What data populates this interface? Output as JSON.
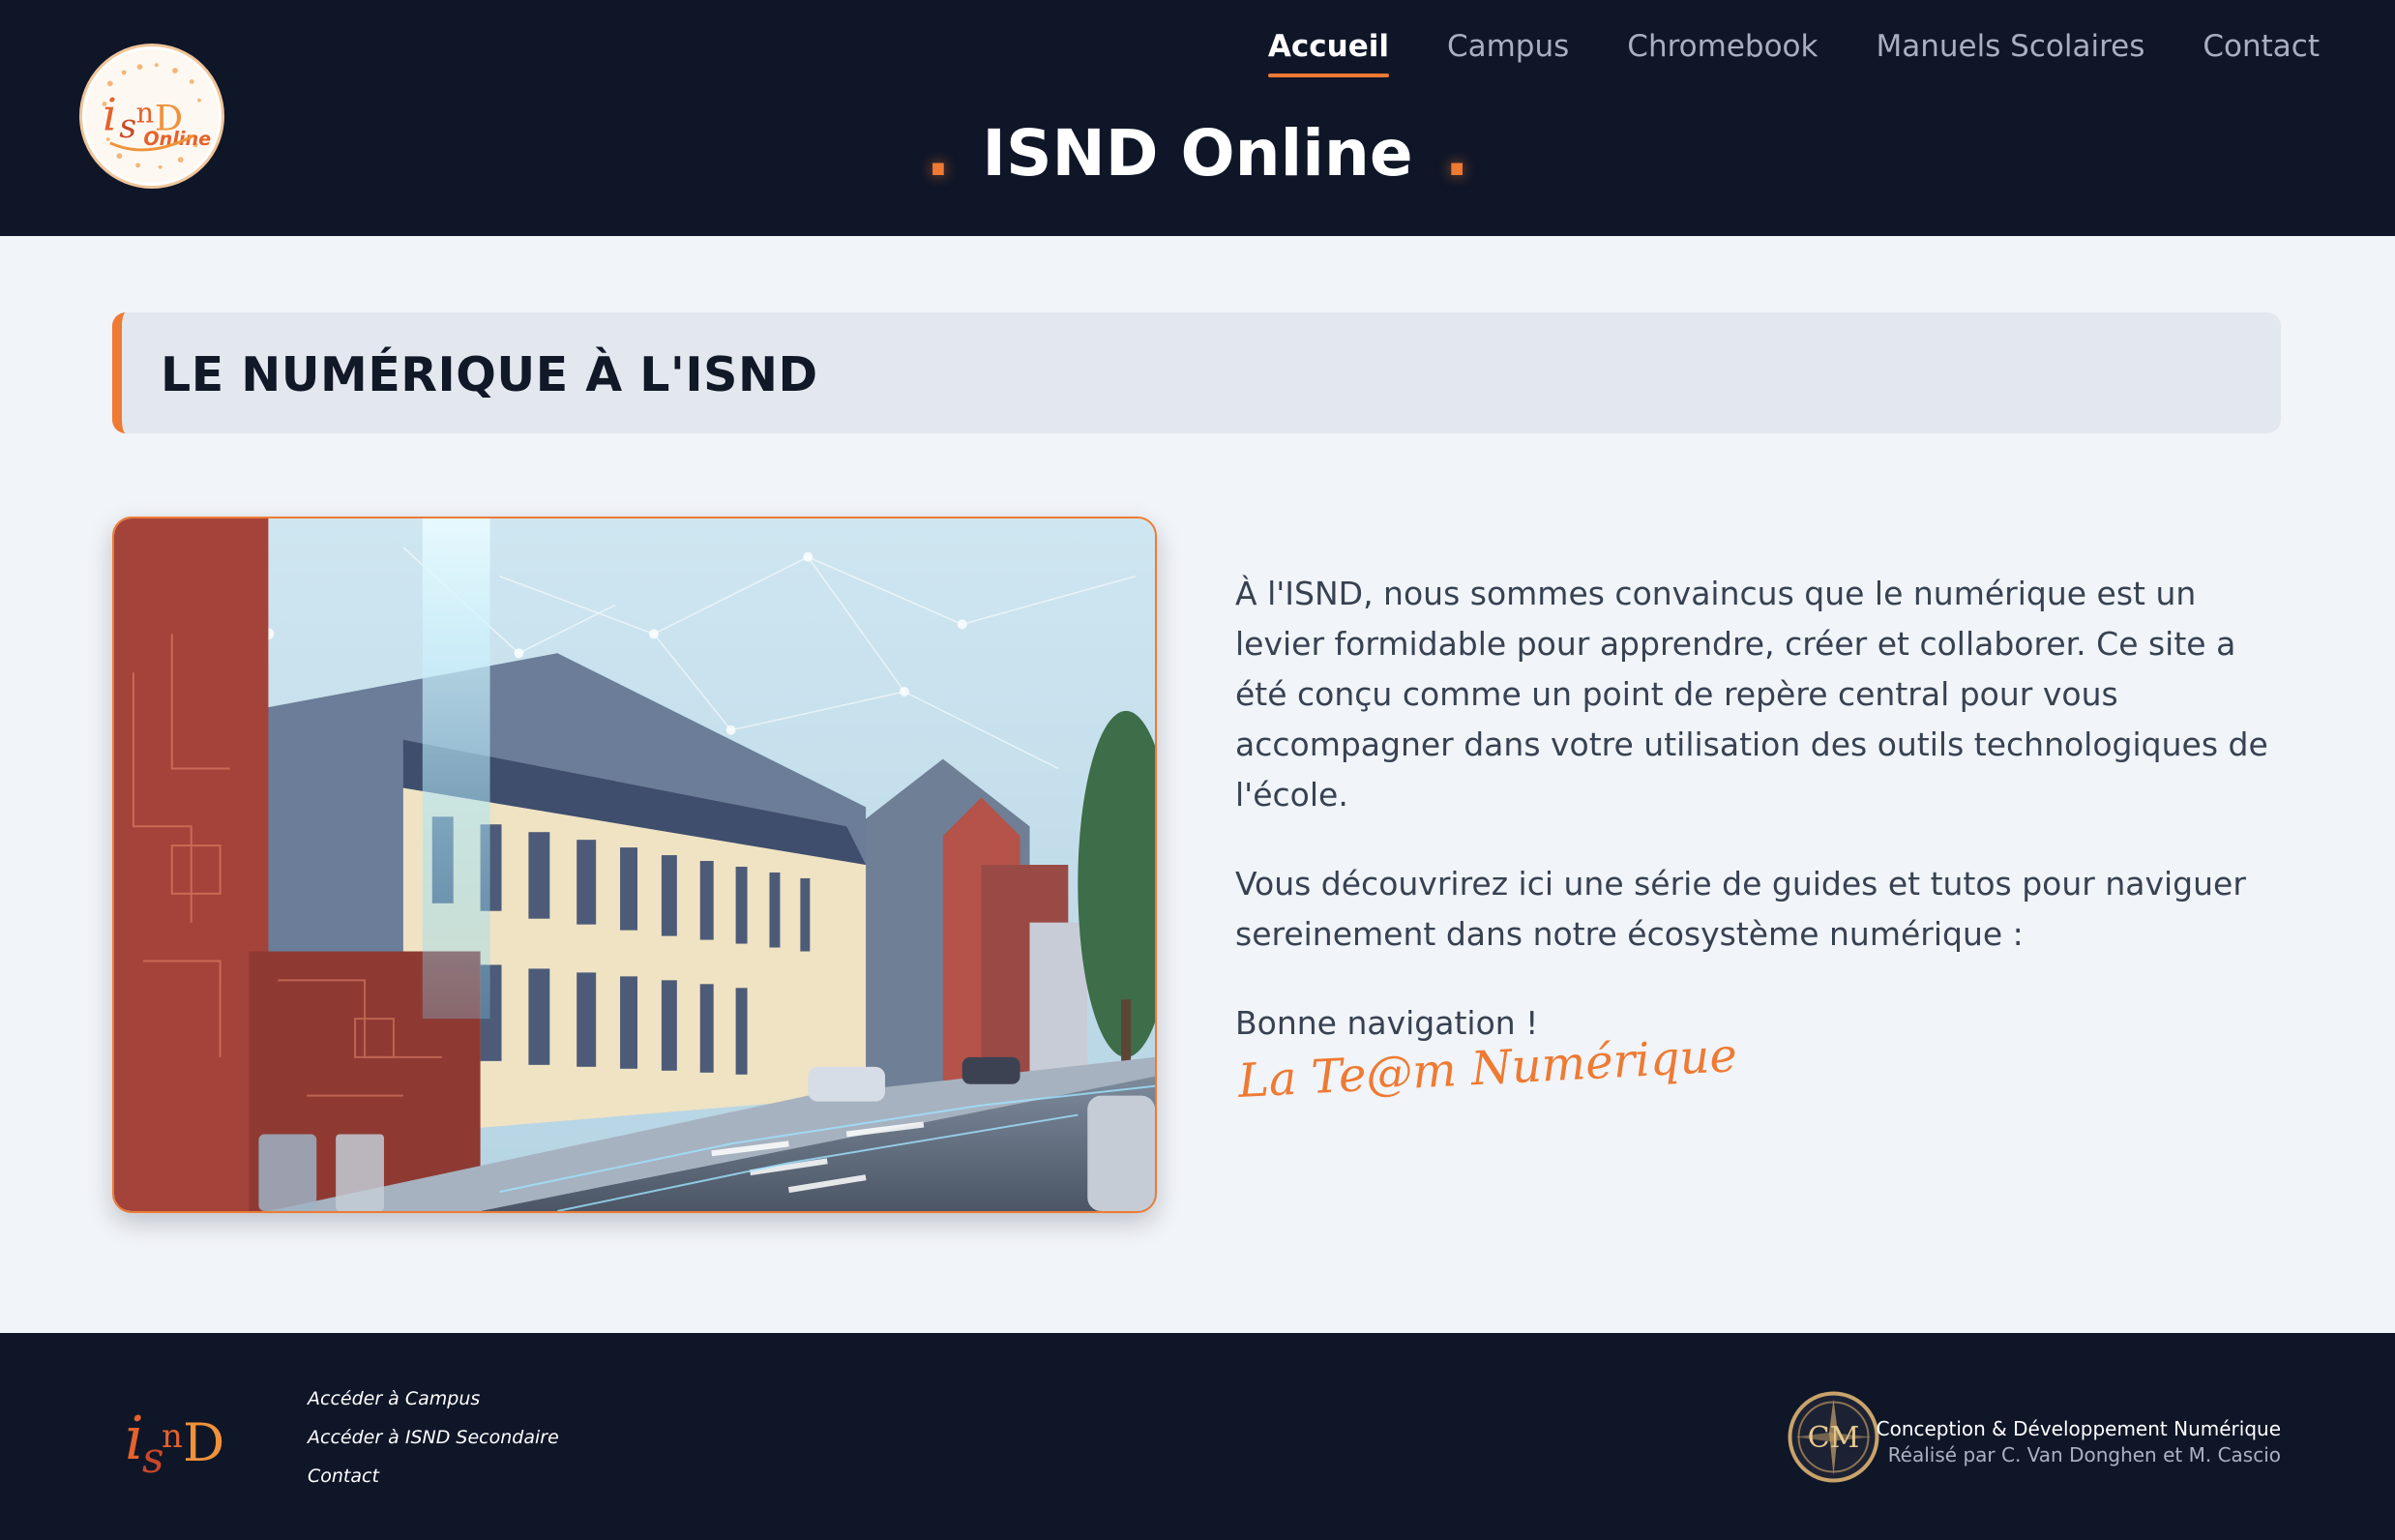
{
  "header": {
    "logo_text": "isnD Online",
    "nav": [
      {
        "label": "Accueil",
        "active": true
      },
      {
        "label": "Campus",
        "active": false
      },
      {
        "label": "Chromebook",
        "active": false
      },
      {
        "label": "Manuels Scolaires",
        "active": false
      },
      {
        "label": "Contact",
        "active": false
      }
    ],
    "site_title": "ISND Online",
    "title_dot": "."
  },
  "section": {
    "heading": "LE NUMÉRIQUE À L'ISND"
  },
  "content": {
    "paragraphs": [
      "À l'ISND, nous sommes convaincus que le numérique est un levier formidable pour apprendre, créer et collaborer. Ce site a été conçu comme un point de repère central pour vous accompagner dans votre utilisation des outils technologiques de l'école.",
      "Vous découvrirez ici une série de guides et tutos pour naviguer sereinement dans notre écosystème numérique :",
      "Bonne navigation !"
    ],
    "signature": "La Te@m Numérique"
  },
  "footer": {
    "logo_text": "isnD",
    "links": [
      "Accéder à Campus",
      "Accéder à ISND Secondaire",
      "Contact"
    ],
    "badge_text": "CM",
    "credit_line1": "Conception & Développement Numérique",
    "credit_line2": "Réalisé par C. Van Donghen et M. Cascio"
  },
  "colors": {
    "accent": "#ee7a33",
    "dark_bg": "#0f1628",
    "page_bg": "#f1f4f8",
    "heading_bg": "#e3e8ef"
  }
}
